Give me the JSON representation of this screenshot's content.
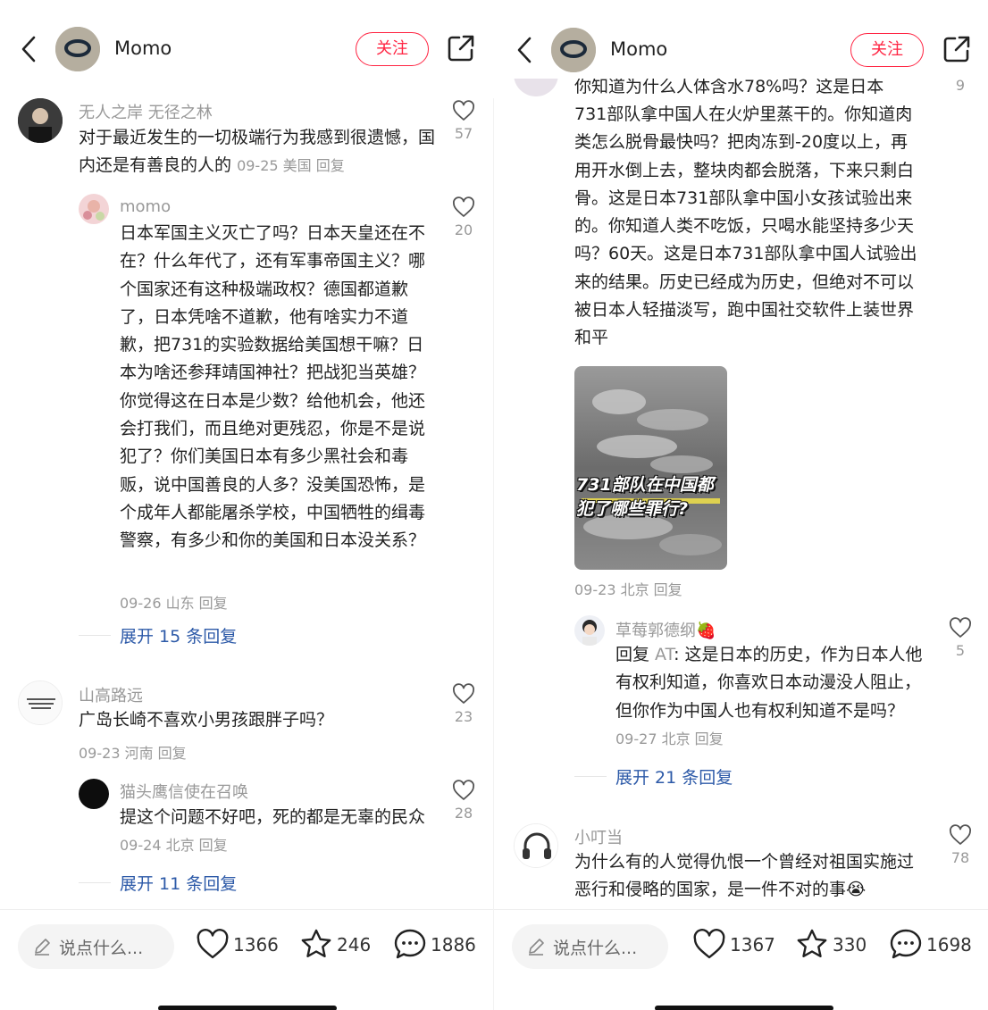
{
  "left": {
    "header": {
      "author": "Momo",
      "follow_label": "关注"
    },
    "comments": [
      {
        "user": "无人之岸 无径之林",
        "text": "对于最近发生的一切极端行为我感到很遗憾，国内还是有善良的人的",
        "meta": "09-25 美国 回复",
        "likes": "57"
      },
      {
        "user": "momo",
        "text": "日本军国主义灭亡了吗？日本天皇还在不在？什么年代了，还有军事帝国主义？哪个国家还有这种极端政权？德国都道歉了，日本凭啥不道歉，他有啥实力不道歉，把731的实验数据给美国想干嘛？日本为啥还参拜靖国神社？把战犯当英雄？你觉得这在日本是少数？给他机会，他还会打我们，而且绝对更残忍，你是不是说犯了？你们美国日本有多少黑社会和毒贩，说中国善良的人多？没美国恐怖，是个成年人都能屠杀学校，中国牺牲的缉毒警察，有多少和你的美国和日本没关系？",
        "meta": "09-26 山东 回复",
        "likes": "20",
        "expand": "展开 15 条回复"
      },
      {
        "user": "山高路远",
        "text": "广岛长崎不喜欢小男孩跟胖子吗？",
        "meta": "09-23 河南 回复",
        "likes": "23"
      },
      {
        "user": "猫头鹰信使在召唤",
        "text": "提这个问题不好吧，死的都是无辜的民众",
        "meta": "09-24 北京 回复",
        "likes": "28",
        "expand": "展开 11 条回复"
      }
    ],
    "bottom": {
      "placeholder": "说点什么...",
      "likes": "1366",
      "favorites": "246",
      "comments": "1886"
    }
  },
  "right": {
    "header": {
      "author": "Momo",
      "follow_label": "关注"
    },
    "comments": [
      {
        "partial_top": "你知道为什么人体含水78%吗？这是日本",
        "text": "731部队拿中国人在火炉里蒸干的。你知道肉类怎么脱骨最快吗？把肉冻到-20度以上，再用开水倒上去，整块肉都会脱落，下来只剩白骨。这是日本731部队拿中国小女孩试验出来的。你知道人类不吃饭，只喝水能坚持多少天吗？60天。这是日本731部队拿中国人试验出来的结果。历史已经成为历史，但绝对不可以被日本人轻描淡写，跑中国社交软件上装世界和平",
        "image_caption": "731部队在中国都犯了哪些罪行?",
        "meta": "09-23 北京 回复",
        "likes": "9"
      },
      {
        "user": "草莓郭德纲🍓",
        "reply_prefix": "回复 ",
        "reply_to": "AT",
        "text": ": 这是日本的历史，作为日本人他有权利知道，你喜欢日本动漫没人阻止，但你作为中国人也有权利知道不是吗？",
        "meta": "09-27 北京 回复",
        "likes": "5",
        "expand": "展开 21 条回复"
      },
      {
        "user": "小叮当",
        "text": "为什么有的人觉得仇恨一个曾经对祖国实施过恶行和侵略的国家，是一件不对的事😭",
        "likes": "78"
      }
    ],
    "bottom": {
      "placeholder": "说点什么...",
      "likes": "1367",
      "favorites": "330",
      "comments": "1698"
    }
  },
  "colors": {
    "accent": "#ff2442",
    "link": "#2d5aa8",
    "muted": "#999999"
  }
}
